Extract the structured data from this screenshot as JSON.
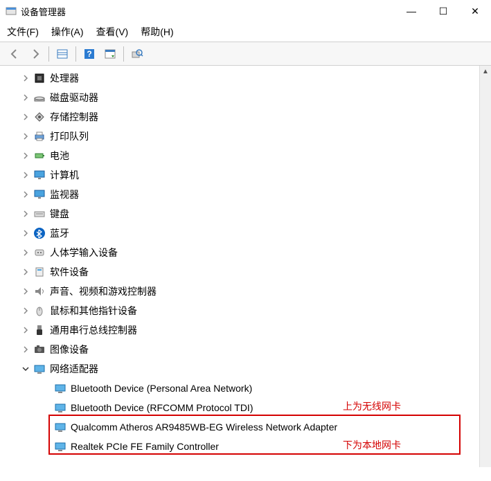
{
  "window": {
    "title": "设备管理器"
  },
  "win_controls": {
    "min": "—",
    "max": "☐",
    "close": "✕"
  },
  "menubar": {
    "file": "文件(F)",
    "action": "操作(A)",
    "view": "查看(V)",
    "help": "帮助(H)"
  },
  "toolbar": {
    "back": "back-icon",
    "forward": "forward-icon",
    "show_hide": "properties-icon",
    "help": "help-icon",
    "action2": "action-icon",
    "scan": "scan-icon"
  },
  "tree": {
    "items": [
      {
        "icon": "cpu",
        "label": "处理器",
        "expanded": false
      },
      {
        "icon": "disk",
        "label": "磁盘驱动器",
        "expanded": false
      },
      {
        "icon": "storage",
        "label": "存储控制器",
        "expanded": false
      },
      {
        "icon": "printer",
        "label": "打印队列",
        "expanded": false
      },
      {
        "icon": "battery",
        "label": "电池",
        "expanded": false
      },
      {
        "icon": "monitor",
        "label": "计算机",
        "expanded": false
      },
      {
        "icon": "monitor",
        "label": "监视器",
        "expanded": false
      },
      {
        "icon": "keyboard",
        "label": "键盘",
        "expanded": false
      },
      {
        "icon": "bluetooth",
        "label": "蓝牙",
        "expanded": false
      },
      {
        "icon": "hid",
        "label": "人体学输入设备",
        "expanded": false
      },
      {
        "icon": "software",
        "label": "软件设备",
        "expanded": false
      },
      {
        "icon": "audio",
        "label": "声音、视频和游戏控制器",
        "expanded": false
      },
      {
        "icon": "mouse",
        "label": "鼠标和其他指针设备",
        "expanded": false
      },
      {
        "icon": "usb",
        "label": "通用串行总线控制器",
        "expanded": false
      },
      {
        "icon": "imaging",
        "label": "图像设备",
        "expanded": false
      },
      {
        "icon": "network",
        "label": "网络适配器",
        "expanded": true,
        "children": [
          {
            "label": "Bluetooth Device (Personal Area Network)"
          },
          {
            "label": "Bluetooth Device (RFCOMM Protocol TDI)"
          },
          {
            "label": "Qualcomm Atheros AR9485WB-EG Wireless Network Adapter"
          },
          {
            "label": "Realtek PCIe FE Family Controller"
          }
        ]
      }
    ]
  },
  "annotations": {
    "upper": "上为无线网卡",
    "lower": "下为本地网卡"
  }
}
